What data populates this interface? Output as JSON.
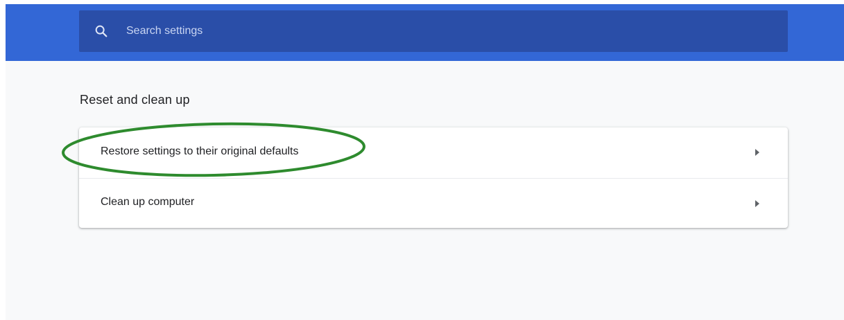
{
  "search": {
    "placeholder": "Search settings",
    "icon": "search-icon"
  },
  "section": {
    "title": "Reset and clean up"
  },
  "rows": [
    {
      "label": "Restore settings to their original defaults",
      "icon": "arrow-right-icon"
    },
    {
      "label": "Clean up computer",
      "icon": "arrow-right-icon"
    }
  ],
  "colors": {
    "header": "#3367d6",
    "search_box": "#2a4ea8",
    "highlight": "#2e8b2e"
  }
}
